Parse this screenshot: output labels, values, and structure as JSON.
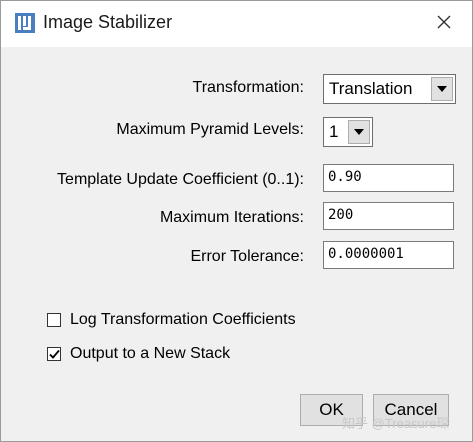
{
  "window": {
    "title": "Image Stabilizer",
    "app_icon": "imagej-icon",
    "close_icon": "close-icon"
  },
  "form": {
    "transformation": {
      "label": "Transformation:",
      "value": "Translation"
    },
    "pyramid": {
      "label": "Maximum Pyramid Levels:",
      "value": "1"
    },
    "template_coeff": {
      "label": "Template Update Coefficient (0..1):",
      "value": "0.90"
    },
    "iterations": {
      "label": "Maximum Iterations:",
      "value": "200"
    },
    "tolerance": {
      "label": "Error Tolerance:",
      "value": "0.0000001"
    }
  },
  "options": {
    "log": {
      "label": "Log Transformation Coefficients",
      "checked": false
    },
    "output": {
      "label": "Output to a New Stack",
      "checked": true
    }
  },
  "buttons": {
    "ok": "OK",
    "cancel": "Cancel"
  },
  "watermark": "知乎 @Treasure琛"
}
